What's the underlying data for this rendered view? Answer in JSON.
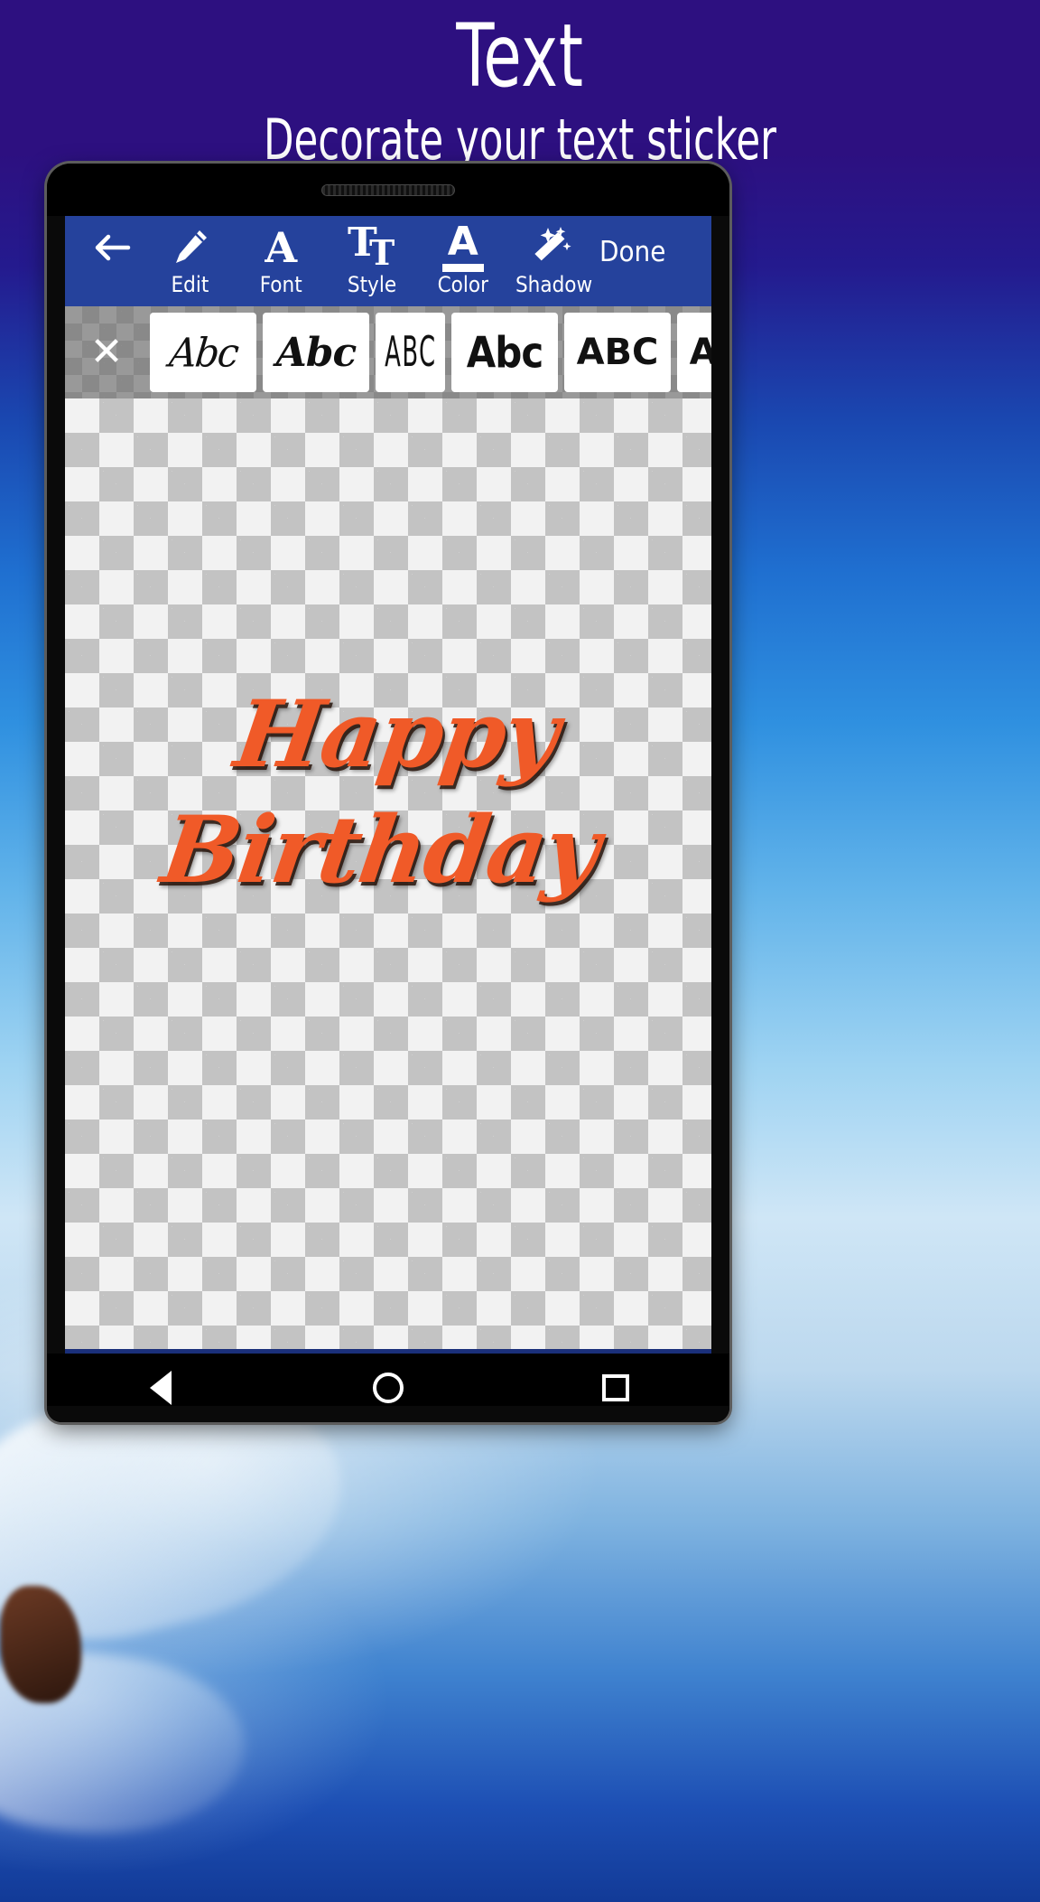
{
  "promo": {
    "title": "Text",
    "subtitle": "Decorate your text sticker"
  },
  "app": {
    "toolbar": {
      "back_icon": "arrow-left-icon",
      "back_glyph": "←",
      "items": [
        {
          "label": "Edit",
          "icon": "pencil-icon"
        },
        {
          "label": "Font",
          "icon": "letter-a-icon"
        },
        {
          "label": "Style",
          "icon": "double-t-icon",
          "glyph_primary": "T",
          "glyph_secondary": "T"
        },
        {
          "label": "Color",
          "icon": "underlined-a-icon",
          "glyph": "A"
        },
        {
          "label": "Shadow",
          "icon": "magic-wand-icon"
        }
      ],
      "done_label": "Done"
    },
    "font_picker": {
      "close_icon": "close-x-icon",
      "close_glyph": "✕",
      "swatches": [
        {
          "label": "Abc",
          "style": "sw-script1",
          "name": "font-swatch-script-1"
        },
        {
          "label": "Abc",
          "style": "sw-script2",
          "name": "font-swatch-script-2"
        },
        {
          "label": "ABC",
          "style": "sw-thin",
          "name": "font-swatch-thin"
        },
        {
          "label": "Abc",
          "style": "sw-fat",
          "name": "font-swatch-fat"
        },
        {
          "label": "ABC",
          "style": "sw-bold",
          "name": "font-swatch-bold"
        },
        {
          "label": "ABC",
          "style": "sw-bold2",
          "name": "font-swatch-bold-2"
        }
      ]
    },
    "canvas": {
      "sticker_line1": "Happy",
      "sticker_line2": "Birthday",
      "sticker_color": "#f05a28",
      "background": "transparent-checkerboard"
    },
    "navbar": {
      "back": "nav-back-triangle",
      "home": "nav-home-circle",
      "recents": "nav-recents-square"
    }
  },
  "colors": {
    "promo_background": "#2d1080",
    "toolbar_blue": "#25429c",
    "sticker_orange": "#f05a28",
    "checker_light": "#f2f2f2",
    "checker_dark": "#c3c3c3"
  }
}
